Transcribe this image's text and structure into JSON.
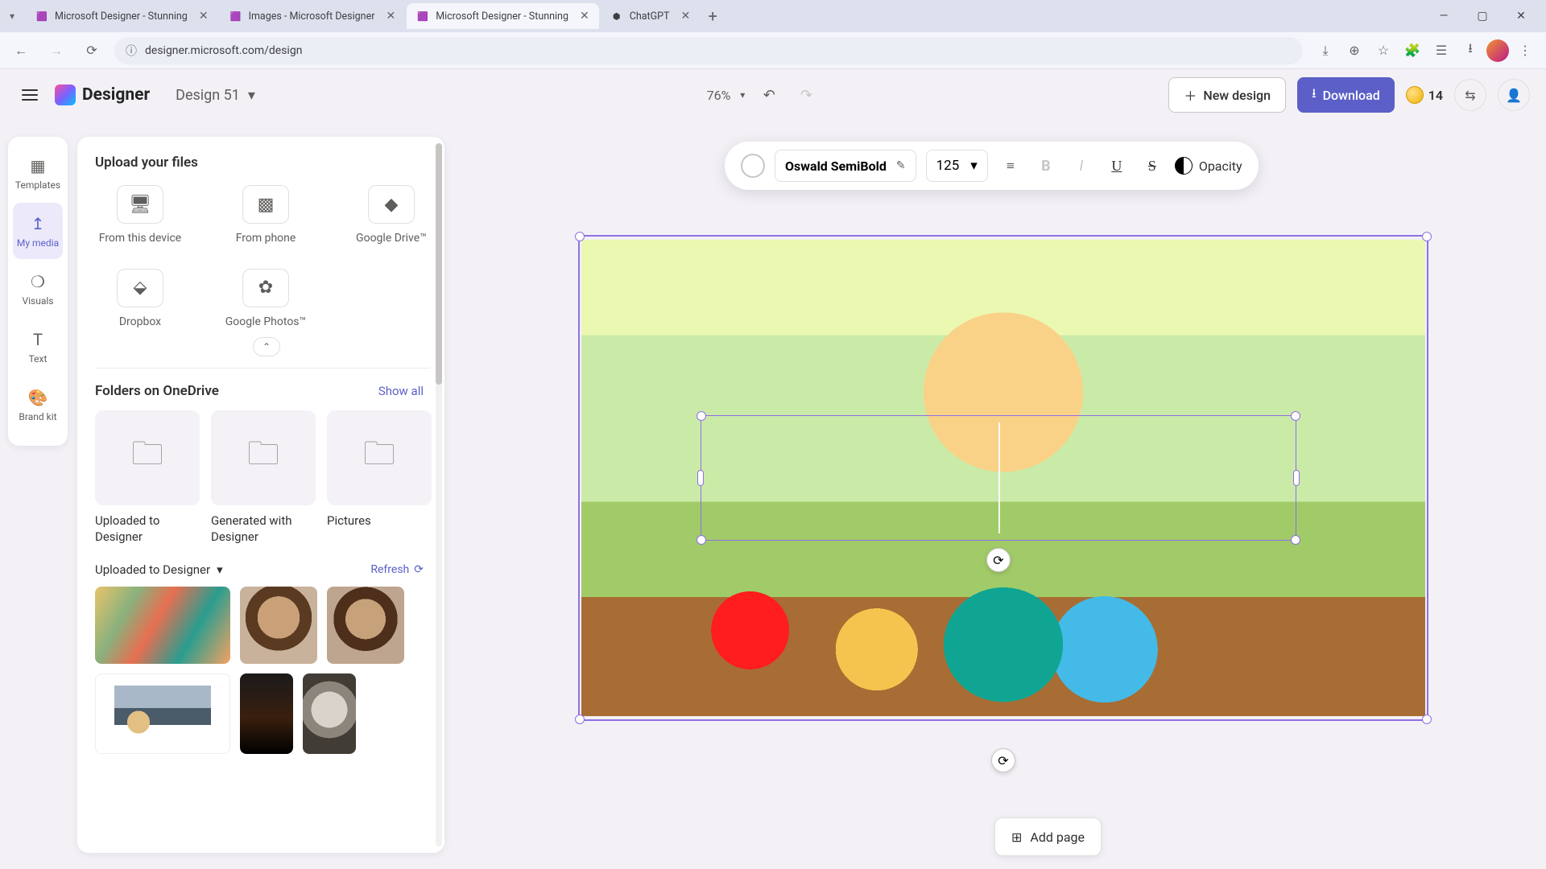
{
  "browser": {
    "tabs": [
      {
        "title": "Microsoft Designer - Stunning",
        "favicon": "🎨",
        "active": false
      },
      {
        "title": "Images - Microsoft Designer",
        "favicon": "🎨",
        "active": false
      },
      {
        "title": "Microsoft Designer - Stunning",
        "favicon": "🎨",
        "active": true
      },
      {
        "title": "ChatGPT",
        "favicon": "✴",
        "active": false
      }
    ],
    "url": "designer.microsoft.com/design"
  },
  "header": {
    "brand": "Designer",
    "design_name": "Design 51",
    "zoom": "76%",
    "new_design": "New design",
    "download": "Download",
    "credits": "14"
  },
  "rail": {
    "items": [
      {
        "id": "templates",
        "label": "Templates"
      },
      {
        "id": "my-media",
        "label": "My media"
      },
      {
        "id": "visuals",
        "label": "Visuals"
      },
      {
        "id": "text",
        "label": "Text"
      },
      {
        "id": "brand-kit",
        "label": "Brand kit"
      }
    ],
    "active": "my-media"
  },
  "panel": {
    "upload_title": "Upload your files",
    "upload_sources": [
      {
        "id": "device",
        "label": "From this device"
      },
      {
        "id": "phone",
        "label": "From phone"
      },
      {
        "id": "gdrive",
        "label": "Google Drive™"
      },
      {
        "id": "dropbox",
        "label": "Dropbox"
      },
      {
        "id": "gphotos",
        "label": "Google Photos™"
      }
    ],
    "folders_title": "Folders on OneDrive",
    "show_all": "Show all",
    "folders": [
      {
        "label": "Uploaded to Designer"
      },
      {
        "label": "Generated with Designer"
      },
      {
        "label": "Pictures"
      }
    ],
    "uploads_label": "Uploaded to Designer",
    "refresh": "Refresh"
  },
  "context_toolbar": {
    "font": "Oswald SemiBold",
    "font_size": "125",
    "opacity_label": "Opacity"
  },
  "footer": {
    "add_page": "Add page"
  }
}
